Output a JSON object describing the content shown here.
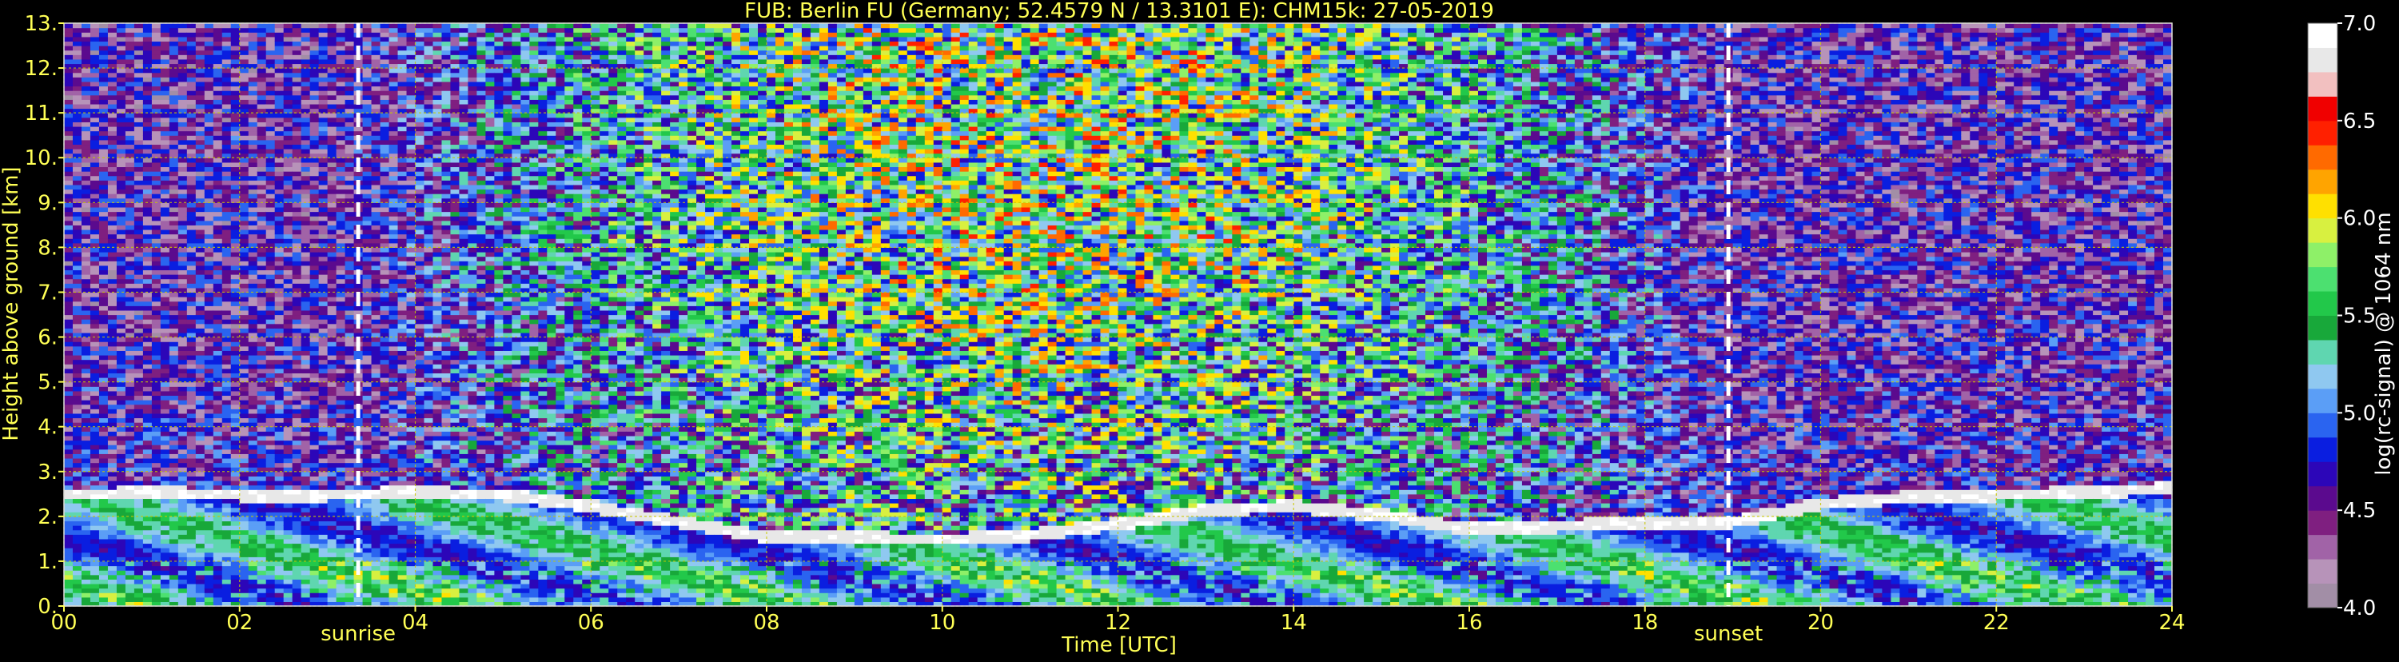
{
  "chart_data": {
    "type": "heatmap",
    "title": "FUB: Berlin FU (Germany; 52.4579 N / 13.3101 E):    CHM15k: 27-05-2019",
    "xlabel": "Time [UTC]",
    "ylabel": "Height above ground [km]",
    "colorbar_label": "log(rc-signal) @ 1064 nm",
    "xlim": [
      0,
      24
    ],
    "ylim": [
      0,
      13
    ],
    "x_ticks": [
      "00",
      "02",
      "04",
      "06",
      "08",
      "10",
      "12",
      "14",
      "16",
      "18",
      "20",
      "22",
      "24"
    ],
    "y_ticks": [
      "0.",
      "1.",
      "2.",
      "3.",
      "4.",
      "5.",
      "6.",
      "7.",
      "8.",
      "9.",
      "10.",
      "11.",
      "12.",
      "13."
    ],
    "colorbar_range": [
      4.0,
      7.0
    ],
    "colorbar_ticks": [
      "4.0",
      "4.5",
      "5.0",
      "5.5",
      "6.0",
      "6.5",
      "7.0"
    ],
    "grid": true,
    "markers": [
      {
        "label": "sunrise",
        "x": 3.35
      },
      {
        "label": "sunset",
        "x": 18.95
      }
    ],
    "boundary_layer_top_km": [
      [
        0,
        2.5
      ],
      [
        1,
        2.55
      ],
      [
        2,
        2.5
      ],
      [
        3,
        2.5
      ],
      [
        4,
        2.55
      ],
      [
        5,
        2.5
      ],
      [
        6,
        2.25
      ],
      [
        7,
        1.9
      ],
      [
        8,
        1.55
      ],
      [
        9,
        1.55
      ],
      [
        10,
        1.5
      ],
      [
        11,
        1.6
      ],
      [
        12,
        1.85
      ],
      [
        13,
        2.15
      ],
      [
        14,
        2.25
      ],
      [
        15,
        2.05
      ],
      [
        16,
        1.75
      ],
      [
        17,
        1.8
      ],
      [
        18,
        1.9
      ],
      [
        19,
        1.9
      ],
      [
        20,
        2.3
      ],
      [
        21,
        2.45
      ],
      [
        22,
        2.5
      ],
      [
        23,
        2.55
      ],
      [
        24,
        2.65
      ]
    ]
  },
  "colors": {
    "background": "#000000",
    "text": "#ffff55",
    "grid": "#c8c800",
    "colorbar_label": "#ffffff",
    "colormap": [
      "#a28ea6",
      "#b793b9",
      "#a163a7",
      "#7f1f80",
      "#5b0a8e",
      "#2c06b8",
      "#0a1ee0",
      "#2a64f0",
      "#5b9ef6",
      "#8fc8f0",
      "#5fd6b0",
      "#18a83a",
      "#22c84a",
      "#4ce070",
      "#8ef068",
      "#d8f040",
      "#ffe000",
      "#ffa400",
      "#ff6a00",
      "#ff2000",
      "#f00000",
      "#f2c0c0",
      "#e8e8e8",
      "#ffffff"
    ]
  }
}
